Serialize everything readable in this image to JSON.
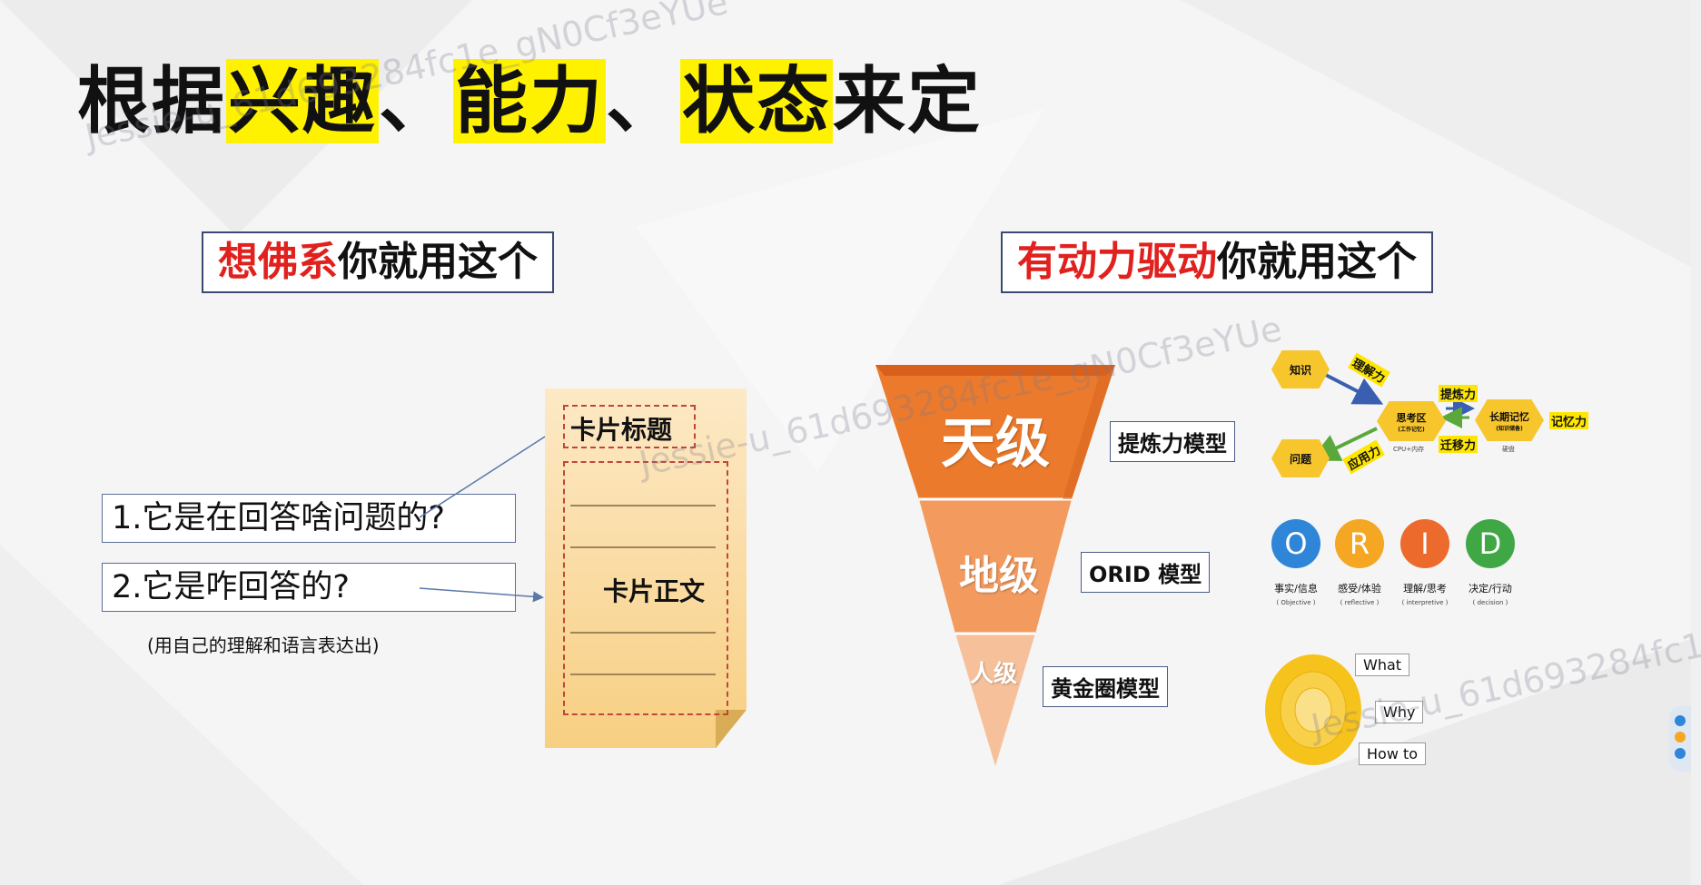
{
  "title": {
    "p1": "根据",
    "h1": "兴趣",
    "s1": "、",
    "h2": "能力",
    "s2": "、",
    "h3": "状态",
    "p2": "来定"
  },
  "left": {
    "label_red": "想佛系",
    "label_rest": "你就用这个",
    "q1": "1.它是在回答啥问题的?",
    "q2": "2.它是咋回答的?",
    "note": "(用自己的理解和语言表达出)",
    "card_title": "卡片标题",
    "card_body": "卡片正文"
  },
  "right": {
    "label_red": "有动力驱动",
    "label_rest": "你就用这个",
    "pyramid": [
      "天级",
      "地级",
      "人级"
    ],
    "models": [
      "提炼力模型",
      "ORID 模型",
      "黄金圈模型"
    ]
  },
  "flow": {
    "zhishi": "知识",
    "wenti": "问题",
    "center": "思考区",
    "center_sub": "(工作记忆)",
    "center_sub2": "CPU+内存",
    "right": "长期记忆",
    "right_sub": "(知识储备)",
    "right_sub2": "硬盘",
    "lijieli": "理解力",
    "yingyongli": "应用力",
    "tilianli": "提炼力",
    "qianyili": "迁移力",
    "jiyili": "记忆力"
  },
  "orid": [
    {
      "letter": "O",
      "cn": "事实/信息",
      "en": "( Objective )",
      "color": "#2f86d8"
    },
    {
      "letter": "R",
      "cn": "感受/体验",
      "en": "( reflective )",
      "color": "#f5a623"
    },
    {
      "letter": "I",
      "cn": "理解/思考",
      "en": "( interpretive )",
      "color": "#ec6a2c"
    },
    {
      "letter": "D",
      "cn": "决定/行动",
      "en": "( decision )",
      "color": "#3fa845"
    }
  ],
  "golden": {
    "what": "What",
    "why": "Why",
    "howto": "How to"
  },
  "watermarks": [
    "Jessie-u_61d693284fc1e_gN0Cf3eYUe"
  ]
}
